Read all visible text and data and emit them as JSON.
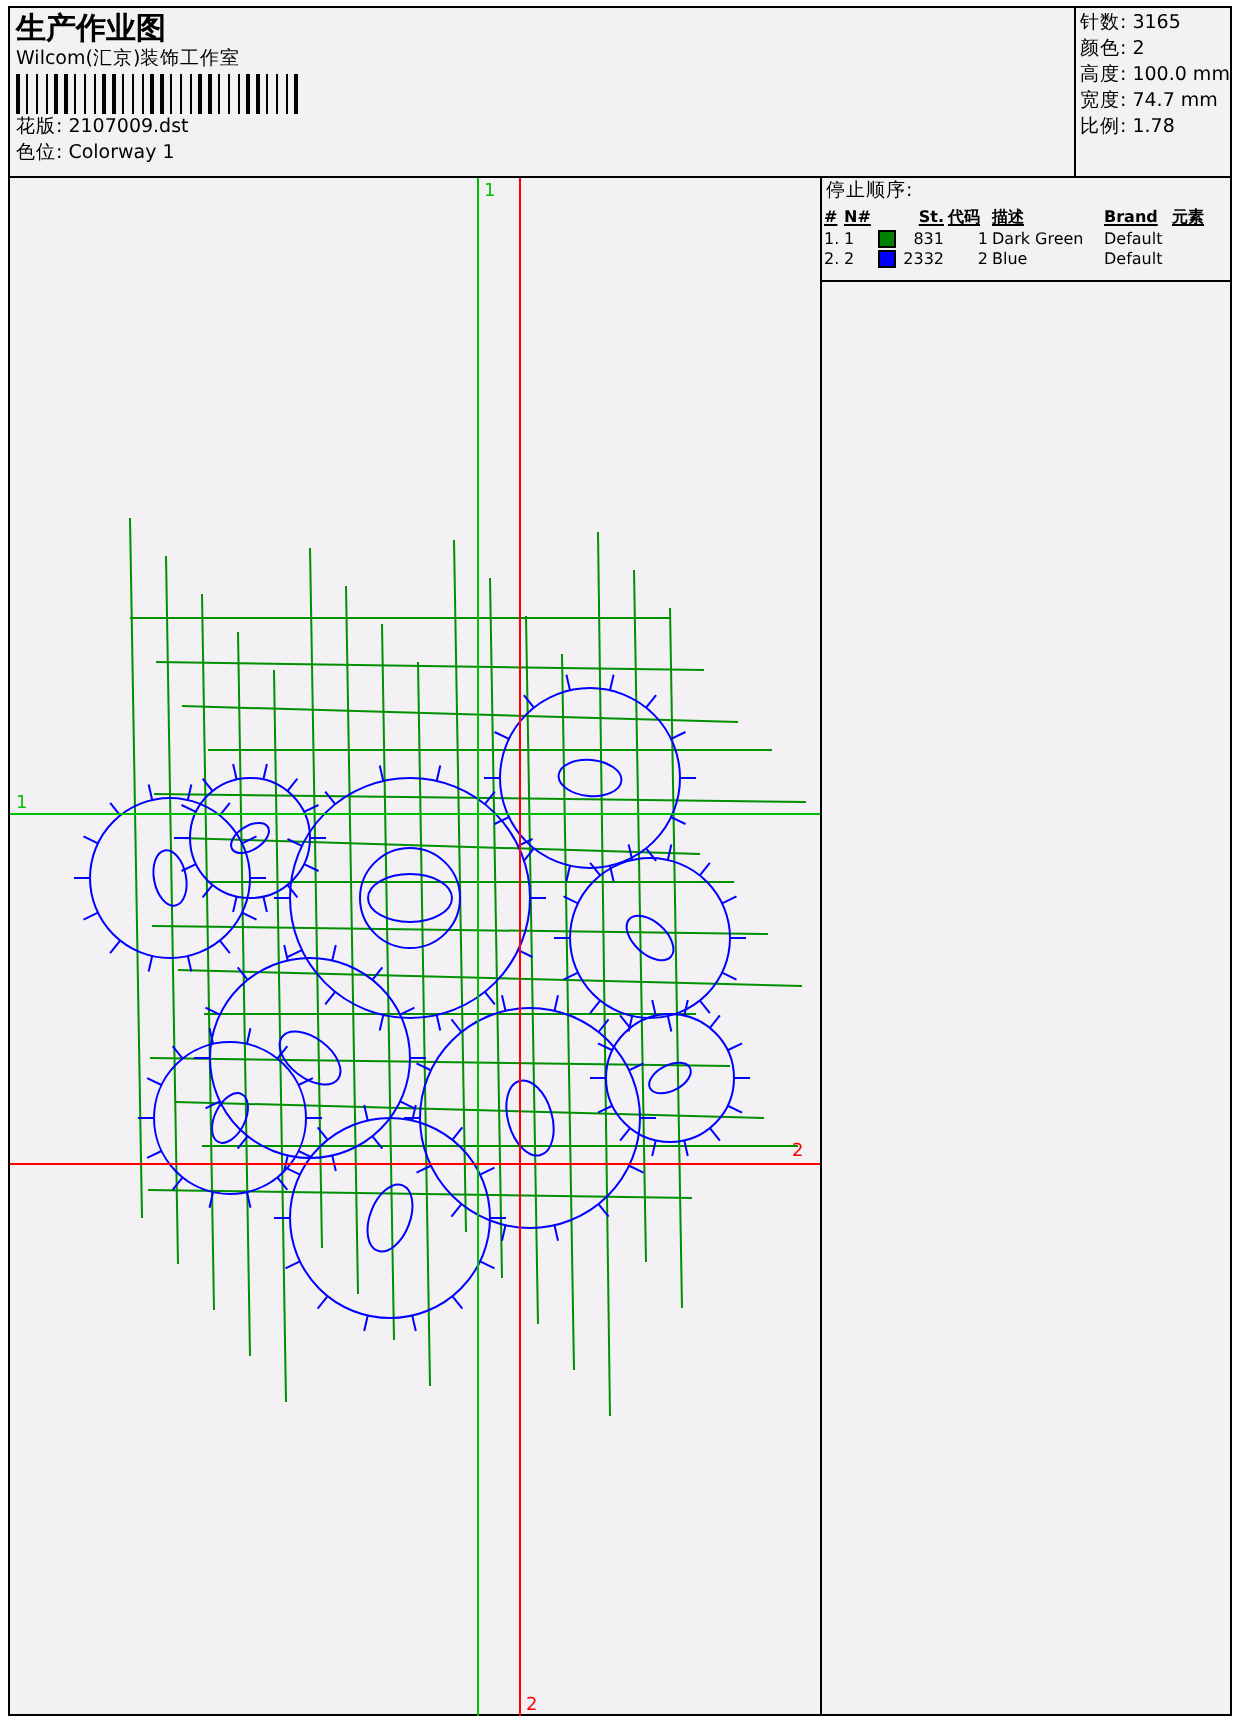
{
  "header": {
    "title": "生产作业图",
    "company": "Wilcom(汇京)装饰工作室",
    "design": "花版: 2107009.dst",
    "colorway": "色位: Colorway 1"
  },
  "stats": [
    "针数: 3165",
    "颜色: 2",
    "高度: 100.0 mm",
    "宽度: 74.7 mm",
    "比例: 1.78"
  ],
  "stop_sequence": {
    "title": "停止顺序:",
    "columns": [
      "#",
      "N#",
      "St.",
      "代码",
      "描述",
      "Brand",
      "元素"
    ],
    "rows": [
      {
        "index": "1.",
        "number": "1",
        "color": "#008000",
        "stitches": "831",
        "code": "1",
        "description": "Dark Green",
        "brand": "Default"
      },
      {
        "index": "2.",
        "number": "2",
        "color": "#0000ff",
        "stitches": "2332",
        "code": "2",
        "description": "Blue",
        "brand": "Default"
      }
    ]
  },
  "design_area": {
    "start_marker": {
      "top_label": "1",
      "left_label": "1"
    },
    "end_marker": {
      "right_label": "2",
      "bottom_label": "2"
    }
  }
}
